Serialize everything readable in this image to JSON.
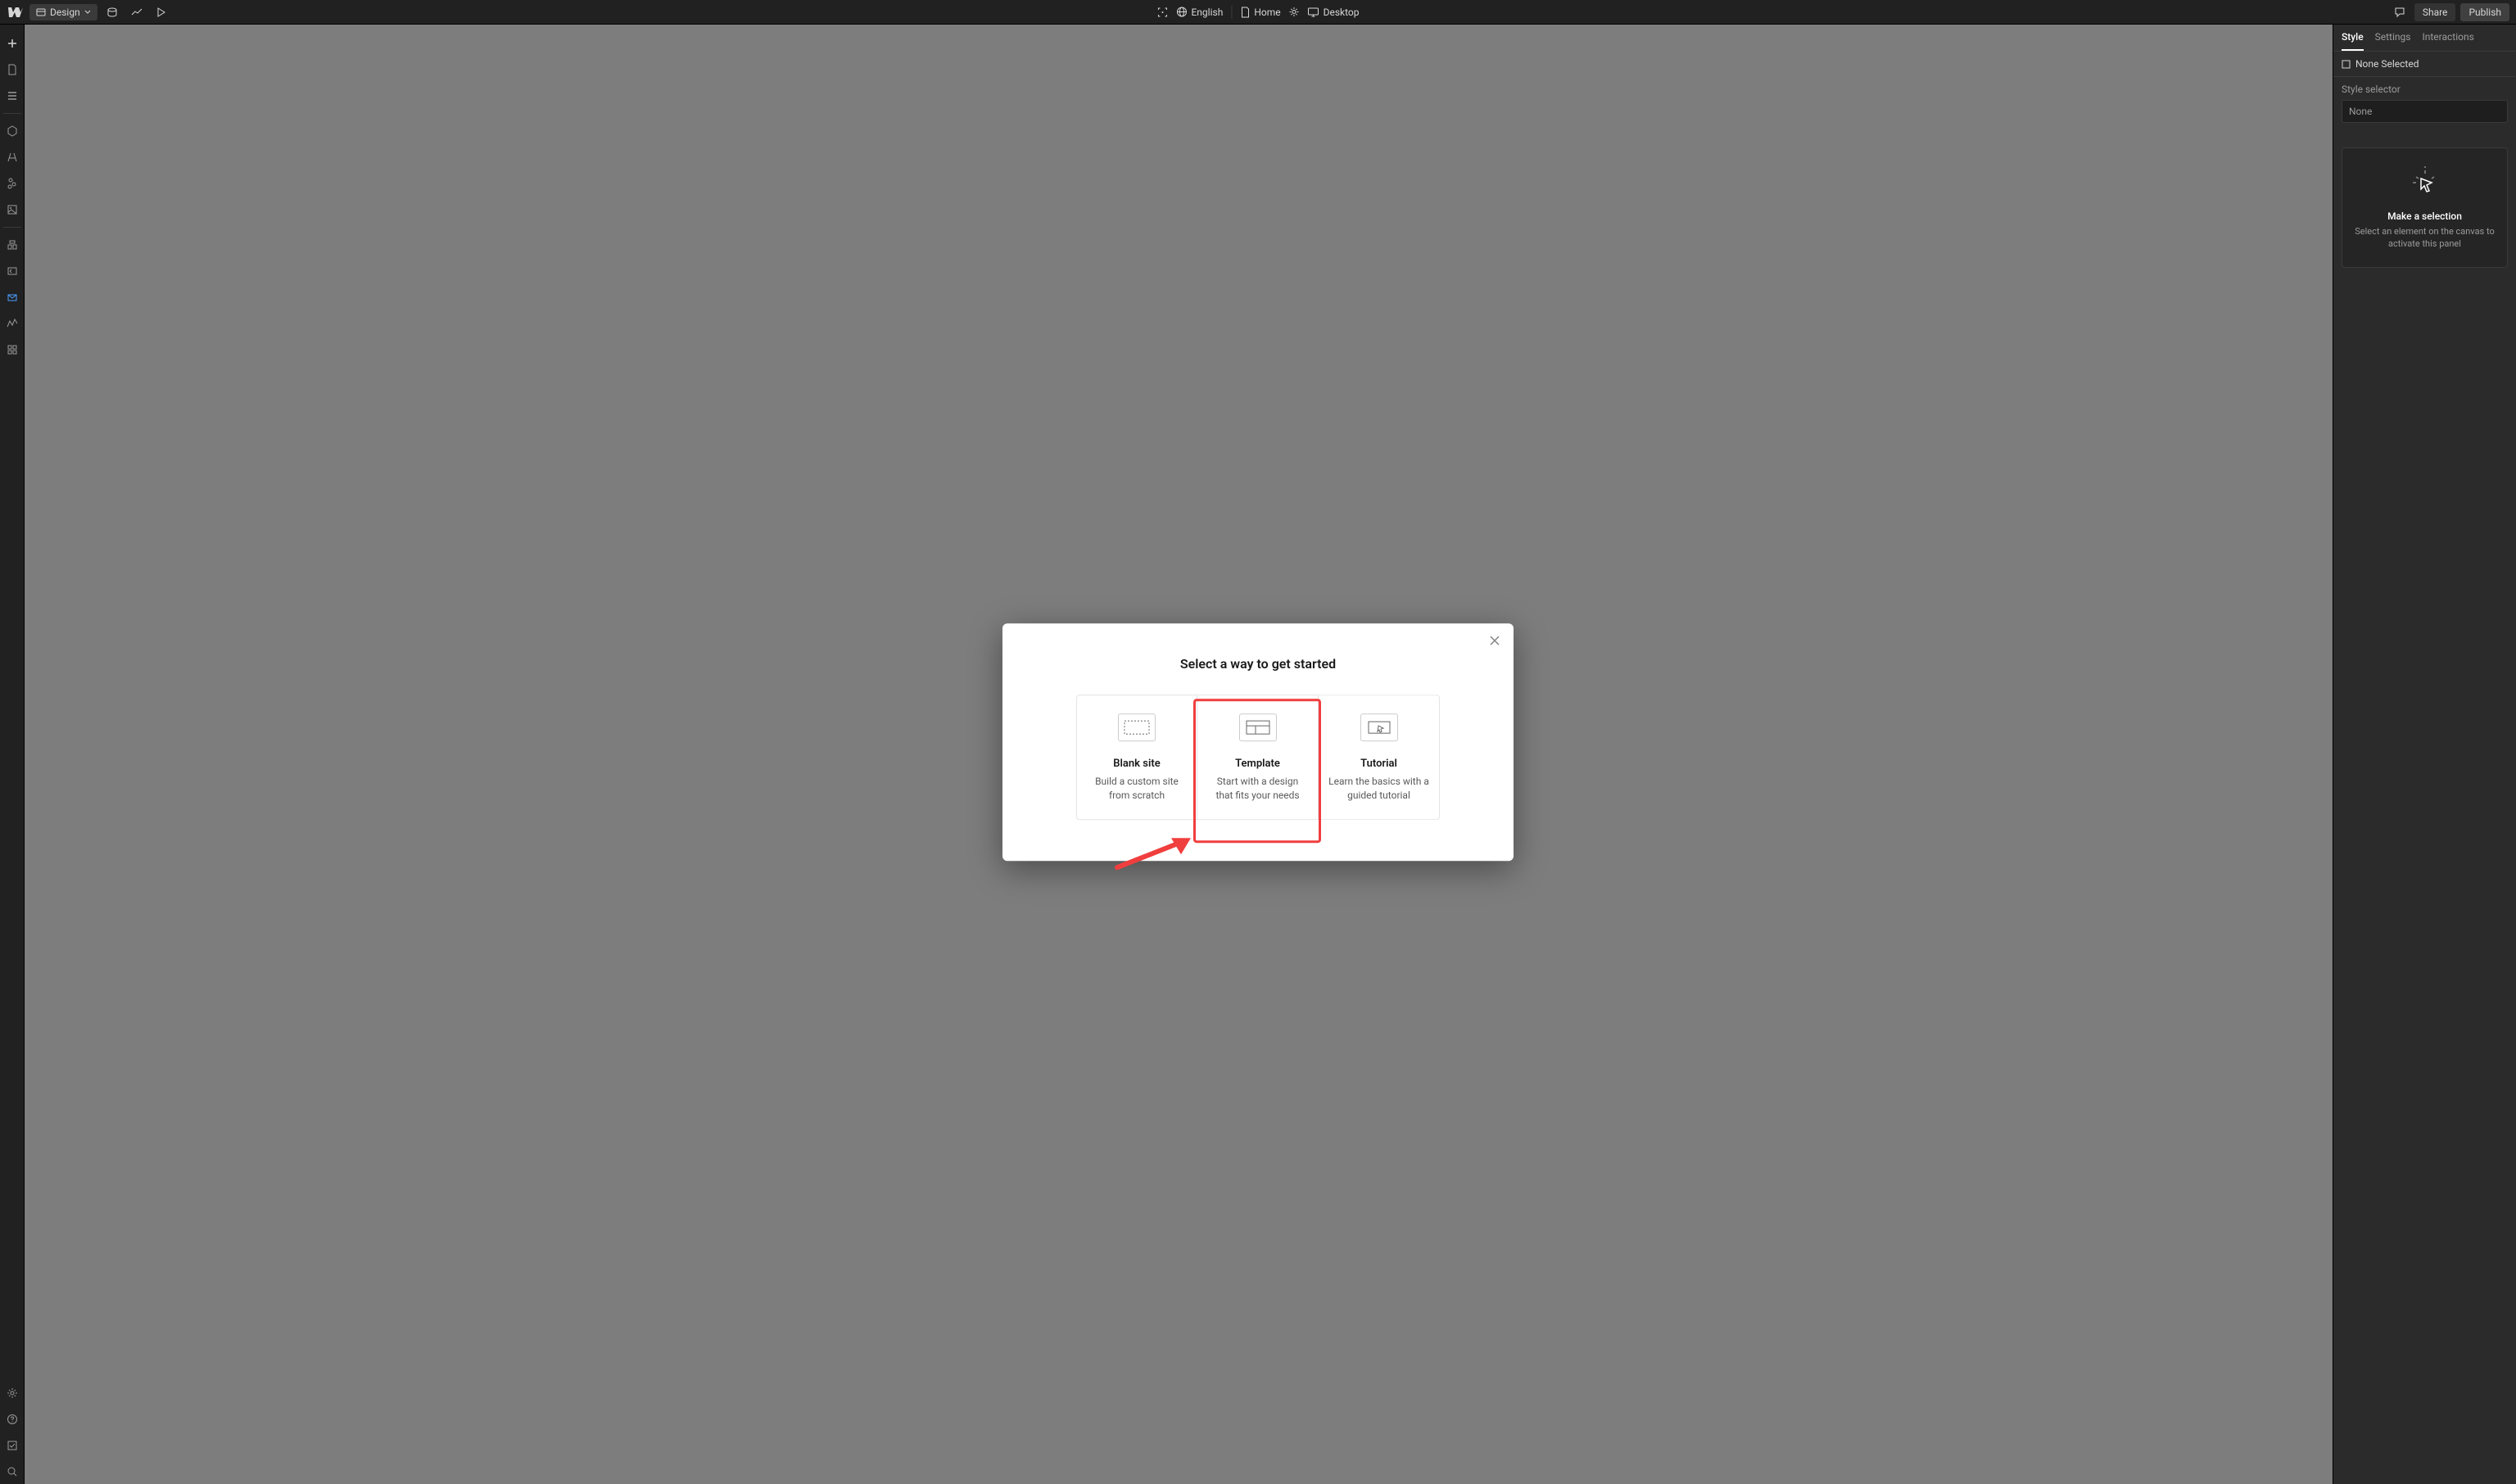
{
  "topbar": {
    "mode_label": "Design",
    "language": "English",
    "page": "Home",
    "breakpoint": "Desktop",
    "share": "Share",
    "publish": "Publish"
  },
  "rightpanel": {
    "tabs": {
      "style": "Style",
      "settings": "Settings",
      "interactions": "Interactions"
    },
    "none_selected": "None Selected",
    "selector_label": "Style selector",
    "selector_value": "None",
    "placeholder_title": "Make a selection",
    "placeholder_sub": "Select an element on the canvas to activate this panel"
  },
  "modal": {
    "title": "Select a way to get started",
    "cards": [
      {
        "title": "Blank site",
        "sub": "Build a custom site from scratch"
      },
      {
        "title": "Template",
        "sub": "Start with a design that fits your needs"
      },
      {
        "title": "Tutorial",
        "sub": "Learn the basics with a guided tutorial"
      }
    ]
  }
}
